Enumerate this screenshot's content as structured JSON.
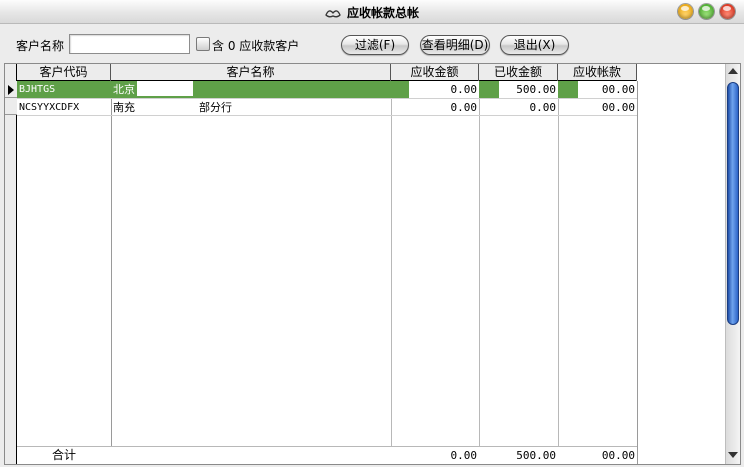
{
  "window": {
    "title": "应收帐款总帐",
    "app_icon": "app-logo-icon",
    "controls": [
      "minimize-icon",
      "zoom-icon",
      "close-icon"
    ]
  },
  "toolbar": {
    "customer_label": "客户名称",
    "customer_input_value": "",
    "customer_input_placeholder": "",
    "checkbox_label": "含 0 应收款客户",
    "checkbox_checked": false,
    "filter_button": "过滤(F)",
    "detail_button": "查看明细(D)",
    "exit_button": "退出(X)"
  },
  "table": {
    "columns": [
      "客户代码",
      "客户名称",
      "应收金额",
      "已收金额",
      "应收帐款"
    ],
    "rows": [
      {
        "code": "BJHTGS",
        "name": "北京",
        "receivable": "0.00",
        "received": "500.00",
        "balance": "00.00",
        "selected": true
      },
      {
        "code": "NCSYYXCDFX",
        "name": "南充",
        "name_suffix": "部分行",
        "receivable": "0.00",
        "received": "0.00",
        "balance": "00.00",
        "selected": false
      }
    ],
    "total": {
      "label": "合计",
      "receivable": "0.00",
      "received": "500.00",
      "balance": "00.00"
    }
  },
  "colors": {
    "selected_row": "#5fa048",
    "window_bg": "#ececec",
    "scroll_thumb": "#3b72d3"
  }
}
